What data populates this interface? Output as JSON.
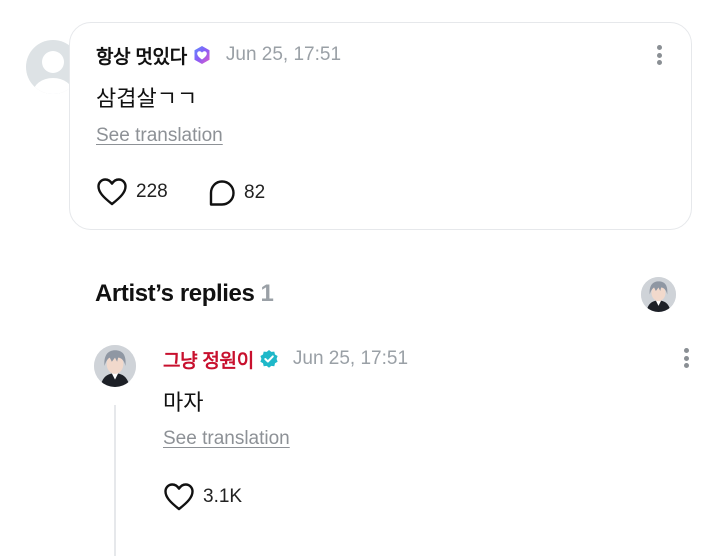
{
  "comment": {
    "user_name": "항상 멋있다",
    "timestamp": "Jun 25, 17:51",
    "text": "삼겹살ㄱㄱ",
    "see_translation": "See translation",
    "likes": "228",
    "replies": "82"
  },
  "artist_replies": {
    "heading": "Artist’s replies",
    "count": "1"
  },
  "reply": {
    "user_name": "그냥 정원이",
    "timestamp": "Jun 25, 17:51",
    "text": "마자",
    "see_translation": "See translation",
    "likes": "3.1K"
  },
  "icons": {
    "comment_badge": "fan-heart-badge-icon",
    "artist_badge": "verified-check-icon",
    "like": "heart-outline-icon",
    "reply": "speech-bubble-icon",
    "more": "more-vertical-icon"
  },
  "colors": {
    "artist_name": "#c8102e",
    "verified": "#1fb8c9",
    "muted": "#9aa0a6"
  }
}
